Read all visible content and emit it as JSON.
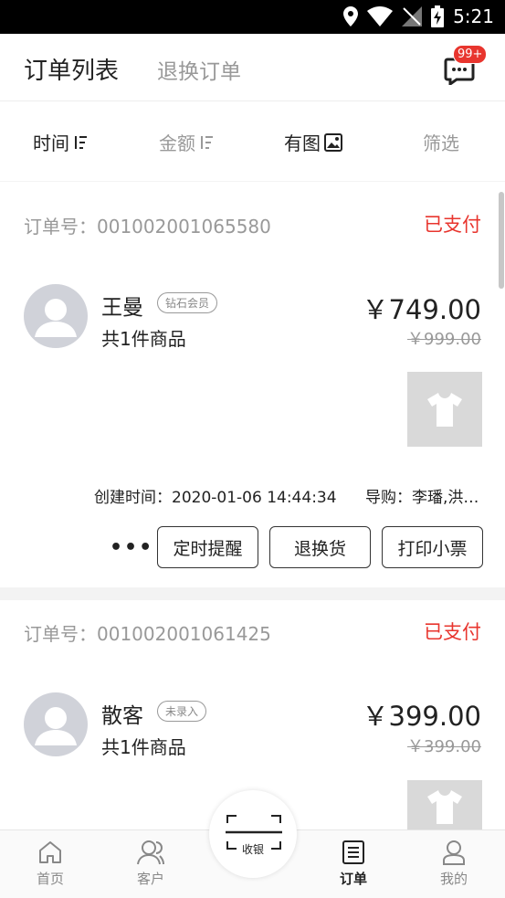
{
  "status_bar": {
    "time": "5:21"
  },
  "header": {
    "tab_active": "订单列表",
    "tab_inactive": "退换订单",
    "badge": "99+"
  },
  "sort_bar": {
    "time": "时间",
    "amount": "金额",
    "has_image": "有图",
    "filter": "筛选"
  },
  "orders": [
    {
      "order_no_label": "订单号：",
      "order_no": "001002001065580",
      "status": "已支付",
      "name": "王曼",
      "tag": "钻石会员",
      "count": "共1件商品",
      "price": "￥749.00",
      "old_price": "￥999.00",
      "created_label": "创建时间：",
      "created": "2020-01-06 14:44:34",
      "guide_label": "导购：",
      "guide": "李璠,洪…",
      "more": "•••",
      "buttons": [
        "定时提醒",
        "退换货",
        "打印小票"
      ]
    },
    {
      "order_no_label": "订单号：",
      "order_no": "001002001061425",
      "status": "已支付",
      "name": "散客",
      "tag": "未录入",
      "count": "共1件商品",
      "price": "￥399.00",
      "old_price": "￥399.00"
    }
  ],
  "bottom_nav": {
    "home": "首页",
    "customer": "客户",
    "cashier": "收银",
    "orders": "订单",
    "mine": "我的"
  }
}
